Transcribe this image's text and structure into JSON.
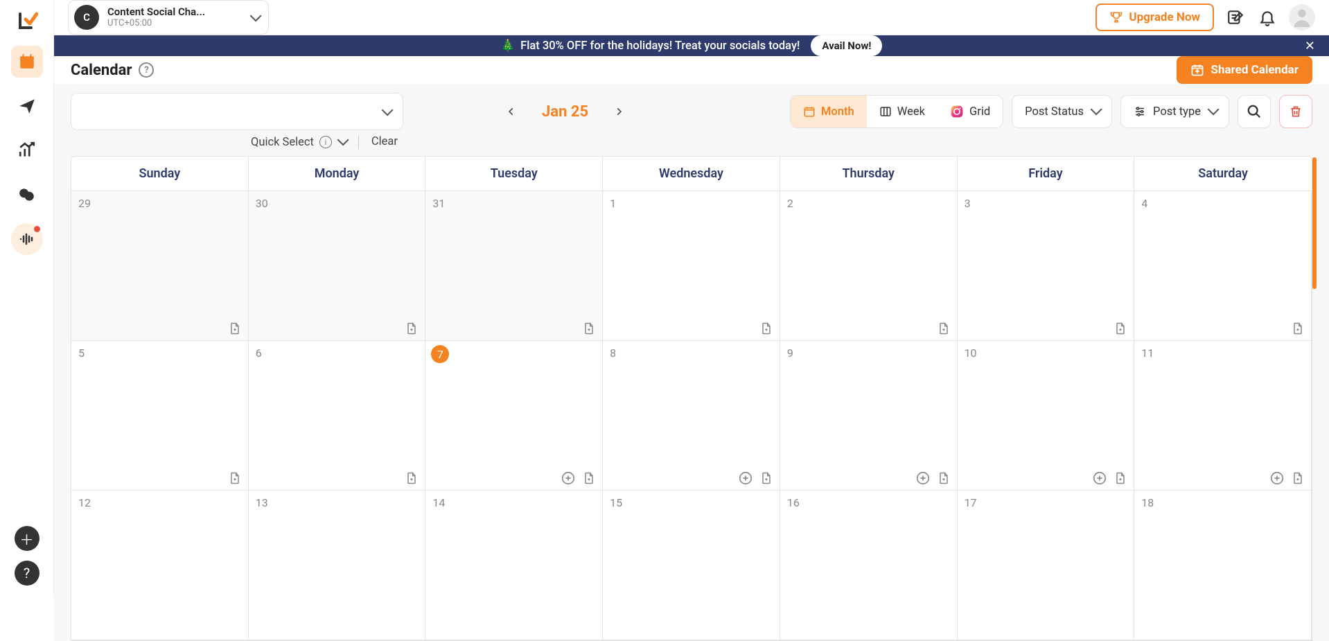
{
  "workspace": {
    "avatar_letter": "C",
    "name": "Content Social Cha...",
    "timezone": "UTC+05:00"
  },
  "upgrade_label": "Upgrade Now",
  "banner": {
    "emoji": "🎄",
    "text": "Flat 30% OFF for the holidays! Treat your socials today!",
    "cta": "Avail Now!"
  },
  "page": {
    "title": "Calendar",
    "shared_button": "Shared Calendar"
  },
  "controls": {
    "month_label": "Jan 25",
    "views": {
      "month": "Month",
      "week": "Week",
      "grid": "Grid"
    },
    "post_status": "Post Status",
    "post_type": "Post type",
    "quick_select": "Quick Select",
    "clear": "Clear"
  },
  "calendar": {
    "days": [
      "Sunday",
      "Monday",
      "Tuesday",
      "Wednesday",
      "Thursday",
      "Friday",
      "Saturday"
    ],
    "cells": [
      {
        "n": "29",
        "out": true,
        "plus": false
      },
      {
        "n": "30",
        "out": true,
        "plus": false
      },
      {
        "n": "31",
        "out": true,
        "plus": false
      },
      {
        "n": "1",
        "plus": false
      },
      {
        "n": "2",
        "plus": false
      },
      {
        "n": "3",
        "plus": false
      },
      {
        "n": "4",
        "plus": false
      },
      {
        "n": "5",
        "plus": false
      },
      {
        "n": "6",
        "plus": false
      },
      {
        "n": "7",
        "today": true,
        "plus": true
      },
      {
        "n": "8",
        "plus": true
      },
      {
        "n": "9",
        "plus": true
      },
      {
        "n": "10",
        "plus": true
      },
      {
        "n": "11",
        "plus": true
      },
      {
        "n": "12"
      },
      {
        "n": "13"
      },
      {
        "n": "14"
      },
      {
        "n": "15"
      },
      {
        "n": "16"
      },
      {
        "n": "17"
      },
      {
        "n": "18"
      }
    ]
  }
}
